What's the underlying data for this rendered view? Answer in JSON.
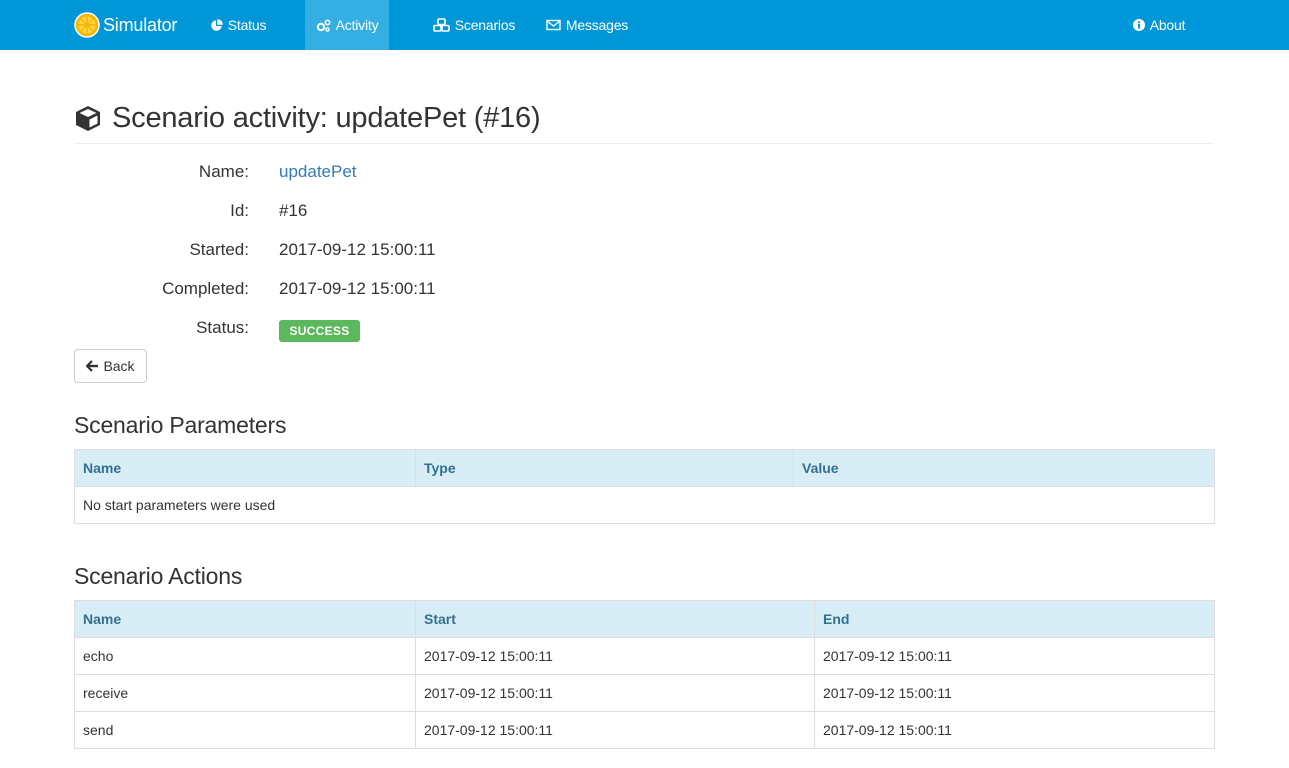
{
  "navbar": {
    "brand": "Simulator",
    "brand_icon": "citrus-logo-icon",
    "items": [
      {
        "label": "Status",
        "icon": "pie-chart-icon"
      },
      {
        "label": "Activity",
        "icon": "cogs-icon",
        "active": true
      },
      {
        "label": "Scenarios",
        "icon": "cubes-icon"
      },
      {
        "label": "Messages",
        "icon": "envelope-icon"
      }
    ],
    "about": {
      "label": "About",
      "icon": "info-circle-icon"
    },
    "colors": {
      "background": "#0097d8",
      "active": "#34aee3"
    }
  },
  "page": {
    "title": "Scenario activity: updatePet (#16)",
    "title_icon": "cube-icon"
  },
  "details": {
    "name_label": "Name:",
    "name_value": "updatePet",
    "id_label": "Id:",
    "id_value": "#16",
    "started_label": "Started:",
    "started_value": "2017-09-12 15:00:11",
    "completed_label": "Completed:",
    "completed_value": "2017-09-12 15:00:11",
    "status_label": "Status:",
    "status_value": "SUCCESS",
    "status_color": "#5cb85c"
  },
  "back_button": {
    "label": "Back",
    "icon": "arrow-left-icon"
  },
  "parameters": {
    "heading": "Scenario Parameters",
    "columns": [
      "Name",
      "Type",
      "Value"
    ],
    "empty_message": "No start parameters were used"
  },
  "actions": {
    "heading": "Scenario Actions",
    "columns": [
      "Name",
      "Start",
      "End"
    ],
    "rows": [
      {
        "name": "echo",
        "start": "2017-09-12 15:00:11",
        "end": "2017-09-12 15:00:11"
      },
      {
        "name": "receive",
        "start": "2017-09-12 15:00:11",
        "end": "2017-09-12 15:00:11"
      },
      {
        "name": "send",
        "start": "2017-09-12 15:00:11",
        "end": "2017-09-12 15:00:11"
      }
    ]
  }
}
